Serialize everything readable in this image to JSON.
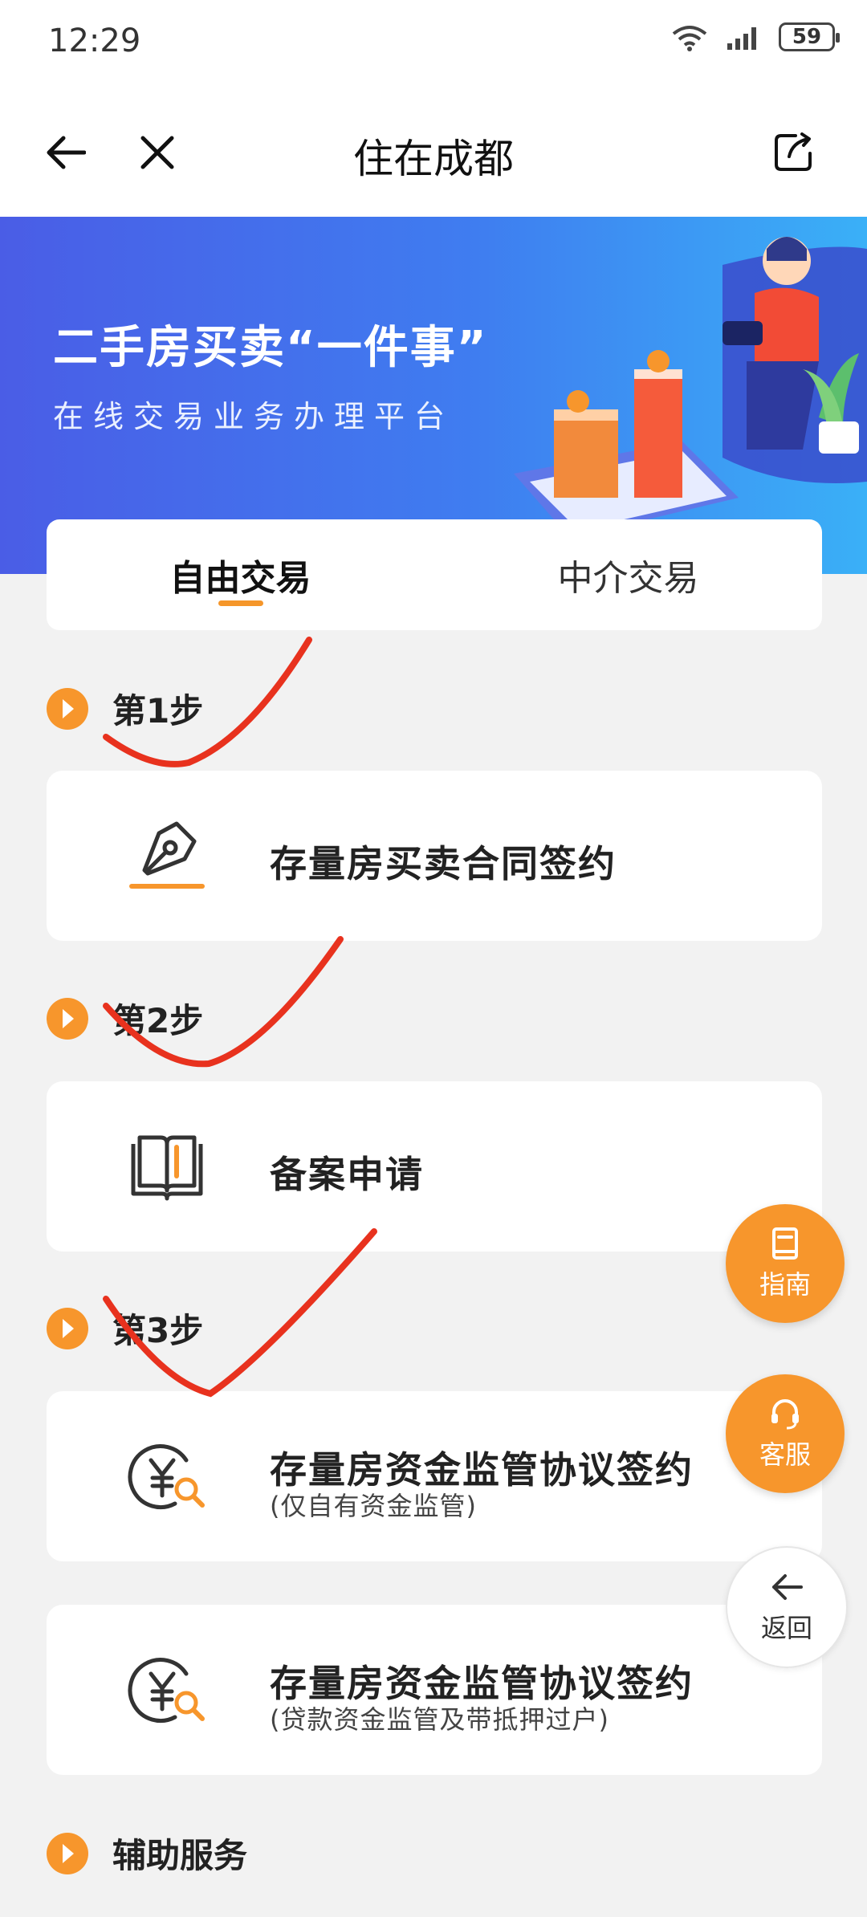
{
  "status_bar": {
    "time": "12:29",
    "battery": "59"
  },
  "nav": {
    "title": "住在成都"
  },
  "banner": {
    "title": "二手房买卖“一件事”",
    "subtitle": "在线交易业务办理平台"
  },
  "tabs": [
    {
      "label": "自由交易",
      "active": true
    },
    {
      "label": "中介交易",
      "active": false
    }
  ],
  "steps": [
    {
      "label": "第1步"
    },
    {
      "label": "第2步"
    },
    {
      "label": "第3步"
    },
    {
      "label": "辅助服务"
    }
  ],
  "cards": [
    {
      "title": "存量房买卖合同签约",
      "subtitle": "",
      "icon": "pen-nib-icon"
    },
    {
      "title": "备案申请",
      "subtitle": "",
      "icon": "book-icon"
    },
    {
      "title": "存量房资金监管协议签约",
      "subtitle": "(仅自有资金监管)",
      "icon": "yuan-search-icon"
    },
    {
      "title": "存量房资金监管协议签约",
      "subtitle": "(贷款资金监管及带抵押过户)",
      "icon": "yuan-search-icon"
    }
  ],
  "floating": {
    "guide_label": "指南",
    "service_label": "客服",
    "back_label": "返回"
  },
  "colors": {
    "accent": "#f7962c",
    "banner_start": "#4a5de6",
    "banner_end": "#3ab0f7",
    "annotation": "#e8321e"
  }
}
